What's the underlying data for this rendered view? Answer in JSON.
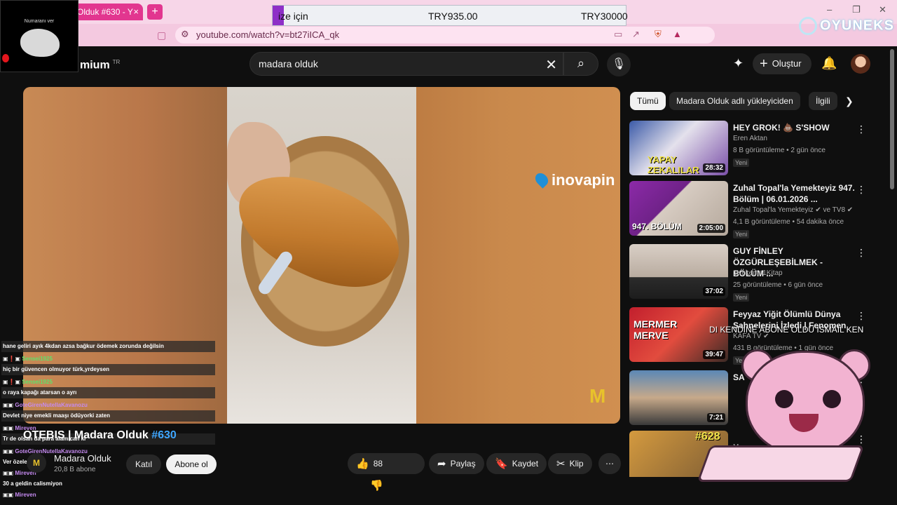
{
  "browser": {
    "tab_title": "Olduk #630 - Y",
    "tab_close": "×",
    "new_tab": "+",
    "url": "youtube.com/watch?v=bt27iICA_qk",
    "window_controls": [
      "–",
      "❐",
      "✕"
    ]
  },
  "price_widget": {
    "label": "ize için",
    "price_1": "TRY935.00",
    "price_2": "TRY30000"
  },
  "webcam": {
    "label": "Numaranı ver"
  },
  "brand_overlay": {
    "text": "OYUNEKS"
  },
  "yt_header": {
    "logo_text": "mium",
    "logo_region": "TR",
    "search_value": "madara olduk",
    "create_label": "Oluştur"
  },
  "player": {
    "sponsor_logo": "inovapin",
    "channel_mark": "M",
    "chat": [
      {
        "kind": "text",
        "text": "hane geliri ayık 4kdan azsa bağkur ödemek zorunda değilsin"
      },
      {
        "kind": "user",
        "name": "Sensei1925",
        "color": "green"
      },
      {
        "kind": "text",
        "text": "hiç bir güvencen olmuyor türk,yrdeysen"
      },
      {
        "kind": "user",
        "name": "Sensei1925",
        "color": "green"
      },
      {
        "kind": "text",
        "text": "o raya kapağı atarsan o ayrı"
      },
      {
        "kind": "user",
        "name": "GoteGirenNutellaKavanozu",
        "color": "purple"
      },
      {
        "kind": "text",
        "text": "Devlet niye emekli maaşı ödüyorki zaten"
      },
      {
        "kind": "user",
        "name": "Mireven",
        "color": "purple"
      },
      {
        "kind": "text",
        "text": "Tr de olsan da para alamıcan ki"
      },
      {
        "kind": "user",
        "name": "GoteGirenNutellaKavanozu",
        "color": "purple"
      },
      {
        "kind": "text",
        "text": "Ver özele gg"
      },
      {
        "kind": "user",
        "name": "Mireven",
        "color": "purple"
      },
      {
        "kind": "text",
        "text": "30 a geldin calismiyon"
      },
      {
        "kind": "user",
        "name": "Mireven",
        "color": "purple"
      }
    ]
  },
  "video": {
    "title": "OTEBIS | Madara Olduk ",
    "episode": "#630",
    "channel_name": "Madara Olduk",
    "subscribers": "20,8 B abone",
    "join_label": "Katıl",
    "subscribe_label": "Abone ol",
    "likes": "88",
    "share_label": "Paylaş",
    "save_label": "Kaydet",
    "clip_label": "Klip",
    "channel_initial": "M"
  },
  "sidebar": {
    "chips": [
      "Tümü",
      "Madara Olduk adlı yükleyiciden",
      "İlgili"
    ],
    "recommendations": [
      {
        "title": "HEY GROK! 💩 S'SHOW",
        "channel": "Eren Aktan",
        "meta": "8 B görüntüleme • 2 gün önce",
        "badge": "Yeni",
        "duration": "28:32",
        "thumb_text": "YAPAY ZEKALILAR"
      },
      {
        "title": "Zuhal Topal'la Yemekteyiz 947. Bölüm | 06.01.2026 ...",
        "channel": "Zuhal Topal'la Yemekteyiz ✔ ve TV8 ✔",
        "meta": "4,1 B görüntüleme • 54 dakika önce",
        "badge": "Yeni",
        "duration": "2:05:00",
        "thumb_text": "947. BÖLÜM"
      },
      {
        "title": "GUY FİNLEY ÖZGÜRLEŞEBİLMEK - BÖLÜM ...",
        "channel": "1Kekeme1Kitap",
        "meta": "25 görüntüleme • 6 gün önce",
        "badge": "Yeni",
        "duration": "37:02",
        "thumb_text": ""
      },
      {
        "title": "Feyyaz Yiğit Ölümlü Dünya Sahnelerini İzledi | Fenomen",
        "channel": "KAFA TV ✔",
        "meta": "431 B görüntüleme • 1 gün önce",
        "badge": "Yeni",
        "duration": "39:47",
        "thumb_text": "MERMER MERVE"
      },
      {
        "title": "SA",
        "channel": "",
        "meta": "",
        "badge": "",
        "duration": "7:21",
        "thumb_text": ""
      },
      {
        "title": "",
        "channel": "M",
        "meta": "",
        "badge": "",
        "duration": "",
        "thumb_text": "#628"
      }
    ]
  },
  "ticker": "DI KENDINE ABONE OLDU ISMAIL KEN"
}
